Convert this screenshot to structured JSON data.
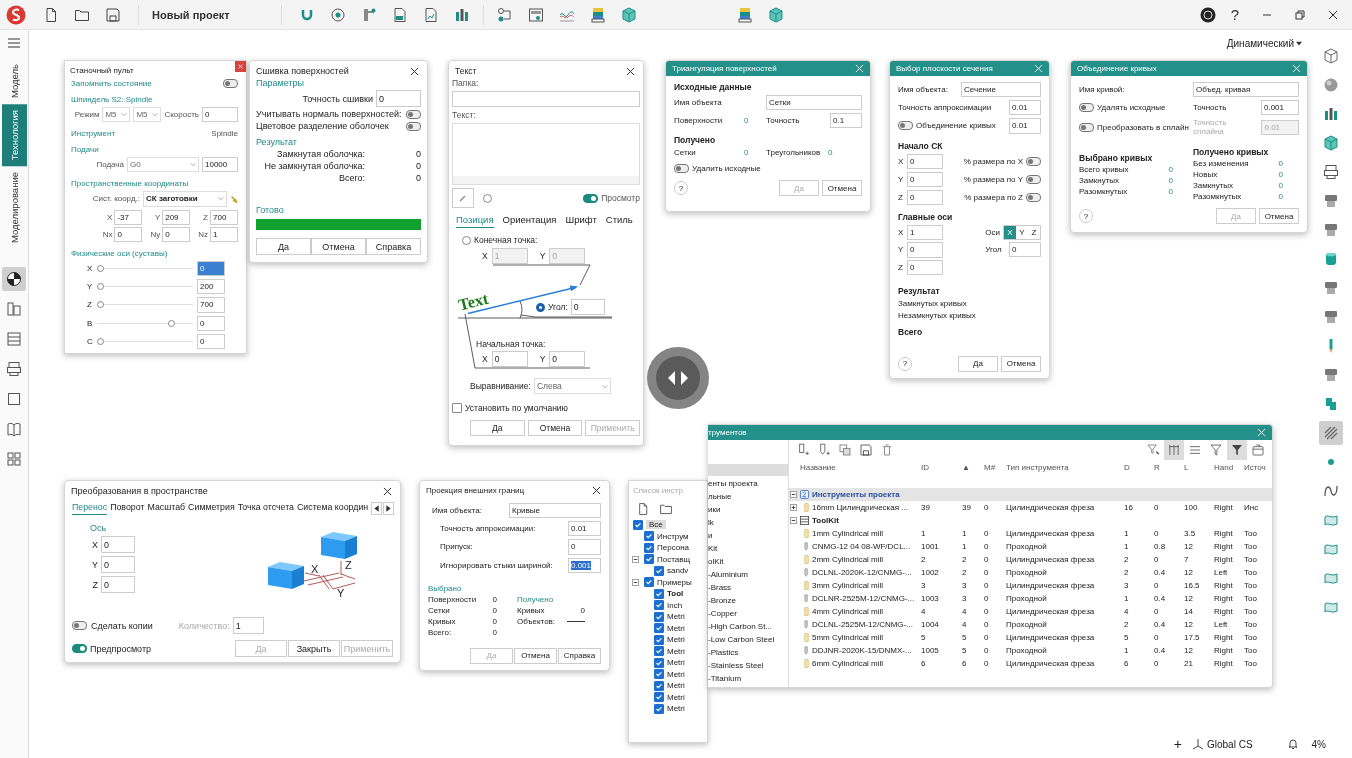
{
  "app": {
    "title": "Новый проект",
    "help": "?",
    "mode": "Динамический"
  },
  "left_tabs": [
    {
      "label": "Модель",
      "selected": false
    },
    {
      "label": "Технология",
      "selected": true
    },
    {
      "label": "Моделирование",
      "selected": false
    }
  ],
  "left_tools": [
    {
      "kind": "pie",
      "selected": true
    },
    {
      "kind": "machine",
      "selected": false
    },
    {
      "kind": "stack",
      "selected": false
    },
    {
      "kind": "printer",
      "selected": false
    },
    {
      "kind": "square",
      "selected": false
    },
    {
      "kind": "book",
      "selected": false
    },
    {
      "kind": "grid",
      "selected": false
    }
  ],
  "right_tools": [
    {
      "kind": "frame",
      "selected": false
    },
    {
      "kind": "sphere",
      "selected": false
    },
    {
      "kind": "cylinders",
      "selected": false
    },
    {
      "kind": "cube",
      "selected": false
    },
    {
      "kind": "printer",
      "selected": false
    },
    {
      "kind": "holder",
      "selected": false
    },
    {
      "kind": "holder",
      "selected": false
    },
    {
      "kind": "cylinder",
      "selected": false
    },
    {
      "kind": "holder",
      "selected": false
    },
    {
      "kind": "holder",
      "selected": false
    },
    {
      "kind": "drill",
      "selected": false
    },
    {
      "kind": "holder",
      "selected": false
    },
    {
      "kind": "bracket",
      "selected": false
    },
    {
      "kind": "hatch",
      "selected": true
    },
    {
      "kind": "dot",
      "selected": false
    },
    {
      "kind": "curve",
      "selected": false
    },
    {
      "kind": "surface",
      "selected": false
    },
    {
      "kind": "surface",
      "selected": false
    },
    {
      "kind": "surface",
      "selected": false
    },
    {
      "kind": "surface",
      "selected": false
    }
  ],
  "status_bar": {
    "add": "+",
    "cs": "Global CS",
    "zoom": "4%"
  },
  "machine_panel": {
    "title": "Станочный пульт",
    "remember": {
      "label": "Запомнить состояние",
      "on": false
    },
    "spindle": {
      "heading": "Шпиндель S2: Spindle",
      "mode_label": "Режим",
      "mode_a": "M5",
      "mode_b": "M5",
      "speed_label": "Скорость",
      "speed": "0"
    },
    "tool": {
      "label": "Инструмент",
      "value": "Spindle"
    },
    "feed": {
      "heading": "Подачи",
      "label": "Подача",
      "mode": "G0",
      "value": "10000"
    },
    "coords": {
      "heading": "Пространственные координаты",
      "cs_label": "Сист. коорд.:",
      "cs": "СК заготовки",
      "fields": [
        {
          "label": "X",
          "value": "-37"
        },
        {
          "label": "Y",
          "value": "209"
        },
        {
          "label": "Z",
          "value": "700"
        },
        {
          "label": "Nx",
          "value": "0"
        },
        {
          "label": "Ny",
          "value": "0"
        },
        {
          "label": "Nz",
          "value": "1"
        }
      ]
    },
    "axes": {
      "heading": "Физические оси (суставы)",
      "items": [
        {
          "label": "X",
          "level": 0,
          "value": "0",
          "selected": true
        },
        {
          "label": "Y",
          "level": 0,
          "value": "200",
          "selected": false
        },
        {
          "label": "Z",
          "level": 0,
          "value": "700",
          "selected": false
        },
        {
          "label": "B",
          "level": 0.8,
          "value": "0",
          "selected": false
        },
        {
          "label": "C",
          "level": 0,
          "value": "0",
          "selected": false
        }
      ]
    }
  },
  "stitch": {
    "title": "Сшивка поверхностей",
    "params_heading": "Параметры",
    "precision_label": "Точность сшивки",
    "precision": "0",
    "toggles": [
      {
        "label": "Учитывать нормаль поверхностей:",
        "on": false
      },
      {
        "label": "Цветовое разделение оболочек",
        "on": false
      }
    ],
    "result_heading": "Результат",
    "results": [
      {
        "label": "Замкнутая оболочка:",
        "value": "0"
      },
      {
        "label": "Не замкнутая оболочка:",
        "value": "0"
      },
      {
        "label": "Всего:",
        "value": "0"
      }
    ],
    "status": "Готово",
    "progress": {
      "level": 1
    },
    "buttons": [
      {
        "label": "Да",
        "disabled": false
      },
      {
        "label": "Отмена",
        "disabled": false
      },
      {
        "label": "Справка",
        "disabled": false
      }
    ]
  },
  "text_dialog": {
    "title": "Текст",
    "folder_label": "Папка:",
    "text_label": "Текст:",
    "option_radio": {
      "selected": false
    },
    "preview": {
      "label": "Просмотр",
      "on": true
    },
    "tabs": [
      {
        "label": "Позиция",
        "selected": true
      },
      {
        "label": "Ориентация",
        "selected": false
      },
      {
        "label": "Шрифт",
        "selected": false
      },
      {
        "label": "Стиль",
        "selected": false
      }
    ],
    "end_point": {
      "label": "Конечная точка:",
      "selected": false,
      "fields": [
        {
          "label": "X",
          "value": "1"
        },
        {
          "label": "Y",
          "value": "0"
        }
      ]
    },
    "sample": "Text",
    "angle": {
      "label": "Угол:",
      "selected": true,
      "value": "0"
    },
    "start_point": {
      "label": "Начальная точка:",
      "fields": [
        {
          "label": "X",
          "value": "0"
        },
        {
          "label": "Y",
          "value": "0"
        }
      ]
    },
    "align_label": "Выравнивание:",
    "align": "Слева",
    "default": {
      "label": "Установить по умолчанию",
      "checked": false
    },
    "buttons": [
      {
        "label": "Да",
        "disabled": false
      },
      {
        "label": "Отмена",
        "disabled": false
      },
      {
        "label": "Применить",
        "disabled": true
      }
    ]
  },
  "triangulation": {
    "title": "Триангуляция поверхностей",
    "source_heading": "Исходные данные",
    "name_label": "Имя объекта",
    "name": "Сетки",
    "surfaces_label": "Поверхности",
    "surfaces": "0",
    "precision_label": "Точность",
    "precision": "0.1",
    "result_heading": "Получено",
    "meshes_label": "Сетки",
    "meshes": "0",
    "triangles_label": "Треугольников",
    "triangles": "0",
    "delete": {
      "label": "Удалить исходные",
      "on": false
    },
    "help": "?",
    "buttons": [
      {
        "label": "Да",
        "disabled": true
      },
      {
        "label": "Отмена",
        "disabled": false
      }
    ]
  },
  "section": {
    "title": "Выбор плоскости сечения",
    "name_label": "Имя объекта:",
    "name": "Сечение",
    "approx_label": "Точность аппроксимации",
    "approx": "0.01",
    "merge": {
      "label": "Объединение кривых",
      "on": false,
      "value": "0.01"
    },
    "origin_heading": "Начало СК",
    "origin": [
      {
        "label": "X",
        "value": "0",
        "pct_label": "% размера по X",
        "on": false
      },
      {
        "label": "Y",
        "value": "0",
        "pct_label": "% размера по Y",
        "on": false
      },
      {
        "label": "Z",
        "value": "0",
        "pct_label": "% размера по Z",
        "on": false
      }
    ],
    "axes_heading": "Главные оси",
    "axes": [
      {
        "label": "X",
        "value": "1"
      },
      {
        "label": "Y",
        "value": "0"
      },
      {
        "label": "Z",
        "value": "0"
      }
    ],
    "axis_label": "Оси",
    "axis_buttons": [
      {
        "label": "X",
        "selected": true
      },
      {
        "label": "Y",
        "selected": false
      },
      {
        "label": "Z",
        "selected": false
      }
    ],
    "angle_label": "Угол",
    "angle": "0",
    "result_heading": "Результат",
    "results": [
      "Замкнутых кривых",
      "Незамкнутых кривых"
    ],
    "total": "Всего",
    "help": "?",
    "buttons": [
      {
        "label": "Да",
        "disabled": false
      },
      {
        "label": "Отмена",
        "disabled": false
      }
    ]
  },
  "curves": {
    "title": "Объединение кривых",
    "name_label": "Имя кривой:",
    "name": "Объед. кривая",
    "toggles": [
      {
        "label": "Удалять исходные",
        "on": false
      },
      {
        "label": "Преобразовать в сплайн",
        "on": false
      }
    ],
    "fields": [
      {
        "label": "Точность",
        "value": "0.001",
        "disabled": false
      },
      {
        "label": "Точность сплайна",
        "value": "0.01",
        "disabled": true
      }
    ],
    "selected_heading": "Выбрано кривых",
    "selected_rows": [
      {
        "label": "Всего кривых",
        "value": "0"
      },
      {
        "label": "Замкнутых",
        "value": "0"
      },
      {
        "label": "Разомкнутых",
        "value": "0"
      }
    ],
    "result_heading": "Получено кривых",
    "result_rows": [
      {
        "label": "Без изменения",
        "value": "0"
      },
      {
        "label": "Новых",
        "value": "0"
      },
      {
        "label": "Замкнутых",
        "value": "0"
      },
      {
        "label": "Разомкнутых",
        "value": "0"
      }
    ],
    "help": "?",
    "buttons": [
      {
        "label": "Да",
        "disabled": true
      },
      {
        "label": "Отмена",
        "disabled": false
      }
    ]
  },
  "transform": {
    "title": "Преобразования в пространстве",
    "tabs": [
      {
        "label": "Перенос",
        "selected": true
      },
      {
        "label": "Поворот",
        "selected": false
      },
      {
        "label": "Масштаб",
        "selected": false
      },
      {
        "label": "Симметрия",
        "selected": false
      },
      {
        "label": "Точка отсчета",
        "selected": false
      },
      {
        "label": "Система координ",
        "selected": false
      }
    ],
    "axis_heading": "Ось",
    "fields": [
      {
        "label": "X",
        "value": "0"
      },
      {
        "label": "Y",
        "value": "0"
      },
      {
        "label": "Z",
        "value": "0"
      }
    ],
    "diagram_labels": [
      "X",
      "Z",
      "Y"
    ],
    "copies": {
      "label": "Сделать копии",
      "on": false
    },
    "count_label": "Количество:",
    "count": "1",
    "preview": {
      "label": "Предпросмотр",
      "on": true
    },
    "buttons": [
      {
        "label": "Да",
        "disabled": true
      },
      {
        "label": "Закрыть",
        "disabled": false
      },
      {
        "label": "Применить",
        "disabled": true
      }
    ]
  },
  "projection": {
    "title": "Проекция внешних границ",
    "name_label": "Имя объекта:",
    "name": "Кривые",
    "fields": [
      {
        "label": "Точность аппроксимации:",
        "value": "0.01",
        "selected": false
      },
      {
        "label": "Припуск:",
        "value": "0",
        "selected": false
      },
      {
        "label": "Игнорировать стыки шириной:",
        "value": "0.001",
        "selected": true
      }
    ],
    "selected_heading": "Выбрано",
    "selected_rows": [
      {
        "label": "Поверхности",
        "value": "0"
      },
      {
        "label": "Сетки",
        "value": "0"
      },
      {
        "label": "Кривых",
        "value": "0"
      },
      {
        "label": "Всего:",
        "value": "0"
      }
    ],
    "result_heading": "Получено",
    "result_rows": [
      {
        "label": "Кривых",
        "value": "0"
      },
      {
        "label": "Объектов:"
      }
    ],
    "buttons": [
      {
        "label": "Да",
        "disabled": true
      },
      {
        "label": "Отмена",
        "disabled": false
      },
      {
        "label": "Справка",
        "disabled": false
      }
    ]
  },
  "tool_list": {
    "title": "Список инстр",
    "tree": [
      {
        "label": "Все",
        "checked": true,
        "selected": true,
        "children": [
          {
            "label": "Инструм",
            "checked": true
          },
          {
            "label": "Персона",
            "checked": true
          },
          {
            "label": "Поставщ",
            "checked": true,
            "expanded": true,
            "children": [
              {
                "label": "sandv",
                "checked": true
              }
            ]
          },
          {
            "label": "Примеры",
            "checked": true,
            "expanded": true,
            "children": [
              {
                "label": "Tool",
                "checked": true
              },
              {
                "label": "Inch",
                "checked": true
              },
              {
                "label": "Metri",
                "checked": true
              },
              {
                "label": "Metri",
                "checked": true
              },
              {
                "label": "Metri",
                "checked": true
              },
              {
                "label": "Metri",
                "checked": true
              },
              {
                "label": "Metri",
                "checked": true
              },
              {
                "label": "Metri",
                "checked": true
              },
              {
                "label": "Metri",
                "checked": true
              },
              {
                "label": "Metri",
                "checked": true
              },
              {
                "label": "Metri",
                "checked": true
              }
            ]
          }
        ]
      }
    ]
  },
  "tool_library": {
    "title": "трументов",
    "tree": [
      "енты проекта",
      "льные",
      "ики",
      "lk",
      "и",
      "Kit",
      "olKit",
      "-Aluminium",
      "-Brass",
      "-Bronze",
      "-Copper",
      "-High Carbon St...",
      "-Low Carbon Steel",
      "-Plastics",
      "-Stainless Steel",
      "-Titanium"
    ],
    "toolbar": [
      {
        "kind": "filter-pick",
        "selected": false
      },
      {
        "kind": "columns",
        "selected": true
      },
      {
        "kind": "list",
        "selected": false
      },
      {
        "kind": "filter",
        "selected": false
      },
      {
        "kind": "filter-dark",
        "selected": true
      },
      {
        "kind": "box",
        "selected": false
      }
    ],
    "columns": [
      "Название",
      "ID",
      "▲",
      "М#",
      "Тип инструмента",
      "D",
      "R",
      "L",
      "Hand",
      "Источ"
    ],
    "groups": [
      {
        "label": "Инструменты проекта",
        "kind": "project",
        "expanded": true,
        "rows": [
          {
            "kind": "mill",
            "has_children": true,
            "cells": [
              "16mm Цилиндрическая ...",
              "39",
              "39",
              "0",
              "Цилиндрическая фреза",
              "16",
              "0",
              "100",
              "Right",
              "Инс"
            ]
          }
        ]
      },
      {
        "label": "ToolKit",
        "kind": "kit",
        "expanded": true,
        "rows": [
          {
            "kind": "mill",
            "has_children": false,
            "cells": [
              "1mm Cylindrical mill",
              "1",
              "1",
              "0",
              "Цилиндрическая фреза",
              "1",
              "0",
              "3.5",
              "Right",
              "Too"
            ]
          },
          {
            "kind": "turning",
            "has_children": false,
            "cells": [
              "CNMG-12 04 08-WF/DCL...",
              "1001",
              "1",
              "0",
              "Проходной",
              "1",
              "0.8",
              "12",
              "Right",
              "Too"
            ]
          },
          {
            "kind": "mill",
            "has_children": false,
            "cells": [
              "2mm Cylindrical mill",
              "2",
              "2",
              "0",
              "Цилиндрическая фреза",
              "2",
              "0",
              "7",
              "Right",
              "Too"
            ]
          },
          {
            "kind": "turning",
            "has_children": false,
            "cells": [
              "DCLNL-2020K-12/CNMG-...",
              "1002",
              "2",
              "0",
              "Проходной",
              "2",
              "0.4",
              "12",
              "Left",
              "Too"
            ]
          },
          {
            "kind": "mill",
            "has_children": false,
            "cells": [
              "3mm Cylindrical mill",
              "3",
              "3",
              "0",
              "Цилиндрическая фреза",
              "3",
              "0",
              "16.5",
              "Right",
              "Too"
            ]
          },
          {
            "kind": "turning",
            "has_children": false,
            "cells": [
              "DCLNR-2525M-12/CNMG-...",
              "1003",
              "3",
              "0",
              "Проходной",
              "1",
              "0.4",
              "12",
              "Right",
              "Too"
            ]
          },
          {
            "kind": "mill",
            "has_children": false,
            "cells": [
              "4mm Cylindrical mill",
              "4",
              "4",
              "0",
              "Цилиндрическая фреза",
              "4",
              "0",
              "14",
              "Right",
              "Too"
            ]
          },
          {
            "kind": "turning",
            "has_children": false,
            "cells": [
              "DCLNL-2525M-12/CNMG-...",
              "1004",
              "4",
              "0",
              "Проходной",
              "2",
              "0.4",
              "12",
              "Left",
              "Too"
            ]
          },
          {
            "kind": "mill",
            "has_children": false,
            "cells": [
              "5mm Cylindrical mill",
              "5",
              "5",
              "0",
              "Цилиндрическая фреза",
              "5",
              "0",
              "17.5",
              "Right",
              "Too"
            ]
          },
          {
            "kind": "turning",
            "has_children": false,
            "cells": [
              "DDJNR-2020K-15/DNMX-...",
              "1005",
              "5",
              "0",
              "Проходной",
              "1",
              "0.4",
              "12",
              "Right",
              "Too"
            ]
          },
          {
            "kind": "mill",
            "has_children": false,
            "cells": [
              "6mm Cylindrical mill",
              "6",
              "6",
              "0",
              "Цилиндрическая фреза",
              "6",
              "0",
              "21",
              "Right",
              "Too"
            ]
          }
        ]
      }
    ]
  }
}
